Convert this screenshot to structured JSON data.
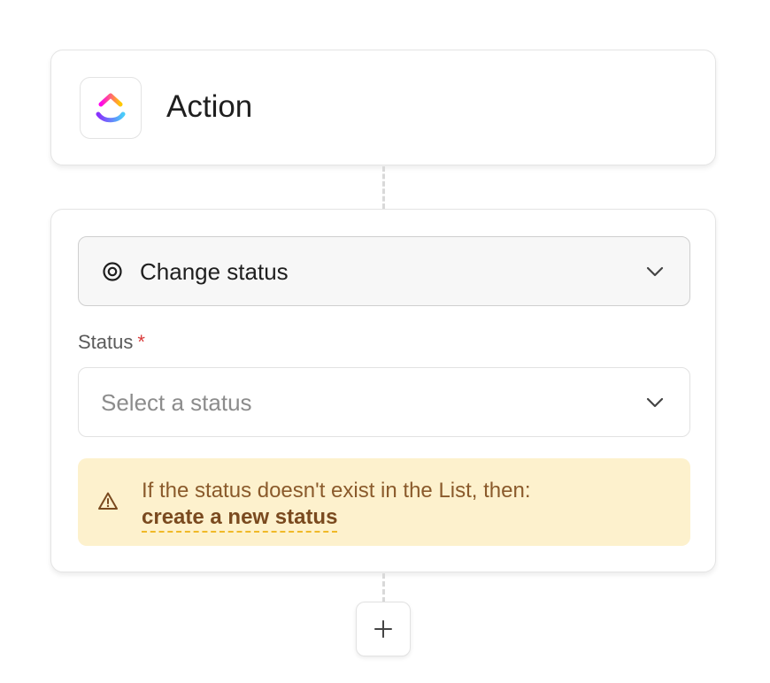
{
  "action_card": {
    "title": "Action",
    "logo_icon": "clickup-logo-icon"
  },
  "action_select": {
    "icon": "target-status-icon",
    "label": "Change status",
    "chevron_icon": "chevron-down-icon"
  },
  "status_field": {
    "label": "Status",
    "required_marker": "*",
    "placeholder": "Select a status",
    "chevron_icon": "chevron-down-icon"
  },
  "warning": {
    "icon": "warning-triangle-icon",
    "text": "If the status doesn't exist in the List, then:",
    "link_label": "create a new status"
  },
  "add_button": {
    "icon": "plus-icon"
  },
  "colors": {
    "warning_bg": "#fdf1cd",
    "warning_text": "#8a5a2b",
    "link_underline": "#f0b928",
    "required": "#d93a3a"
  }
}
